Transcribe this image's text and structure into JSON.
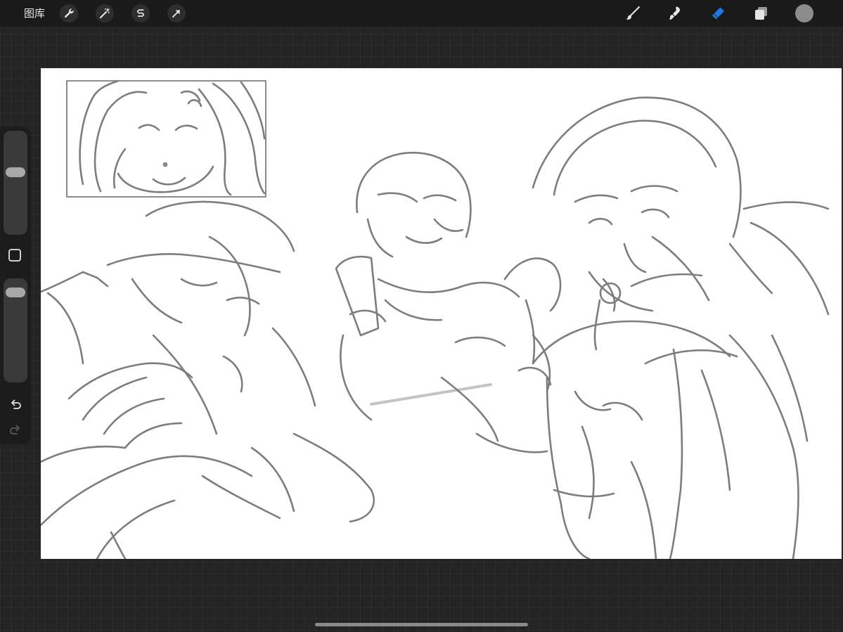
{
  "topbar": {
    "gallery_label": "图库"
  },
  "tools_left": [
    {
      "name": "actions",
      "icon": "wrench-icon"
    },
    {
      "name": "adjustments",
      "icon": "magic-wand-icon"
    },
    {
      "name": "selection",
      "icon": "selection-s-icon"
    },
    {
      "name": "transform",
      "icon": "arrow-cursor-icon"
    }
  ],
  "tools_right": [
    {
      "name": "brush",
      "icon": "brush-icon",
      "active": false
    },
    {
      "name": "smudge",
      "icon": "smudge-icon",
      "active": false
    },
    {
      "name": "eraser",
      "icon": "eraser-icon",
      "active": true
    },
    {
      "name": "layers",
      "icon": "layers-icon",
      "active": false
    }
  ],
  "current_color": "#8c8c8c",
  "accent_color": "#1f7ae0",
  "sidebar": {
    "brush_size_level": 0.38,
    "opacity_level": 0.07
  },
  "canvas": {
    "stroke_color": "#7d7d7d"
  }
}
